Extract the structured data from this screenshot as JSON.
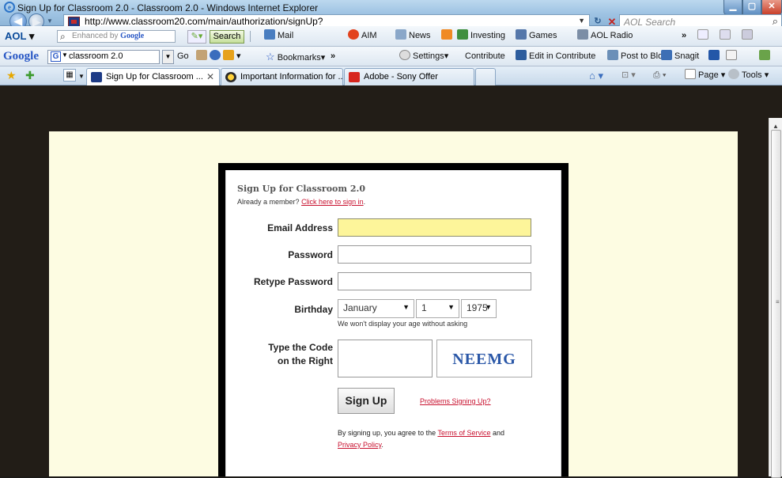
{
  "window": {
    "title": "Sign Up for Classroom 2.0 - Classroom 2.0 - Windows Internet Explorer",
    "min": "▁",
    "max": "▢",
    "close": "✕"
  },
  "address": {
    "url": "http://www.classroom20.com/main/authorization/signUp?",
    "search_placeholder": "AOL Search"
  },
  "aol_toolbar": {
    "logo": "AOL",
    "enhanced_by": "Enhanced by",
    "google": "Google",
    "search_label": "Search",
    "items": [
      "Mail",
      "AIM",
      "News",
      "Investing",
      "Games",
      "AOL Radio"
    ]
  },
  "google_toolbar": {
    "logo": "Google",
    "query": "classroom 2.0",
    "go": "Go",
    "bookmarks": "Bookmarks▾",
    "more": "»",
    "settings": "Settings▾",
    "contribute": "Contribute",
    "edit_in_contribute": "Edit in Contribute",
    "post_to_blog": "Post to Blo",
    "snagit": "Snagit"
  },
  "tabs": [
    {
      "label": "Sign Up for Classroom ...",
      "active": true
    },
    {
      "label": "Important Information for ...",
      "active": false
    },
    {
      "label": "Adobe - Sony Offer",
      "active": false
    }
  ],
  "command_bar": {
    "page": "Page ▾",
    "tools": "Tools ▾"
  },
  "form": {
    "heading": "Sign Up for Classroom 2.0",
    "member_prefix": "Already a member?",
    "member_link": "Click here to sign in",
    "member_suffix": ".",
    "email_label": "Email Address",
    "password_label": "Password",
    "retype_label": "Retype Password",
    "birthday_label": "Birthday",
    "birth_month": "January",
    "birth_day": "1",
    "birth_year": "1975",
    "birthday_hint": "We won't display your age without asking",
    "code_label_1": "Type the Code",
    "code_label_2": "on the Right",
    "captcha_text": "NEEMG",
    "signup_button": "Sign Up",
    "problems_link": "Problems Signing Up?",
    "agree_prefix": "By signing up, you agree to the",
    "terms_link": "Terms of Service",
    "agree_and": "and",
    "privacy_link": "Privacy Policy",
    "agree_suffix": "."
  }
}
